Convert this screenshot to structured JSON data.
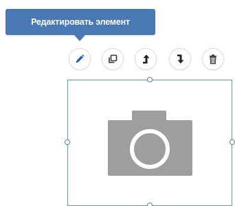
{
  "tooltip": {
    "text": "Редактировать элемент",
    "background": "#4a78b5"
  },
  "toolbar": {
    "buttons": [
      {
        "name": "edit-button",
        "icon": "pencil-icon",
        "color": "#2a5fa8"
      },
      {
        "name": "duplicate-button",
        "icon": "copy-icon",
        "color": "#333333"
      },
      {
        "name": "move-up-button",
        "icon": "arrow-up-icon",
        "color": "#222222"
      },
      {
        "name": "move-down-button",
        "icon": "arrow-down-icon",
        "color": "#222222"
      },
      {
        "name": "delete-button",
        "icon": "trash-icon",
        "color": "#333333"
      }
    ]
  },
  "element": {
    "type": "image-placeholder",
    "icon": "camera-icon",
    "frame_color": "#5b9bd5",
    "placeholder_color": "#9e9e9e"
  }
}
